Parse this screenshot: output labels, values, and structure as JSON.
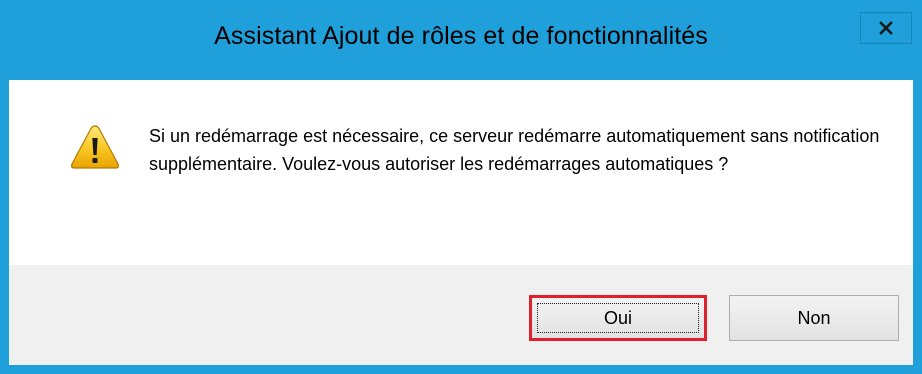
{
  "window": {
    "title": "Assistant Ajout de rôles et de fonctionnalités",
    "close_glyph": "x",
    "accent_color": "#1FA0DB"
  },
  "dialog": {
    "icon": "warning-icon",
    "message": "Si un redémarrage est nécessaire, ce serveur redémarre automatiquement sans notification supplémentaire. Voulez-vous autoriser les redémarrages automatiques ?"
  },
  "buttons": {
    "yes_label": "Oui",
    "no_label": "Non",
    "highlight_color": "#E0202A"
  }
}
